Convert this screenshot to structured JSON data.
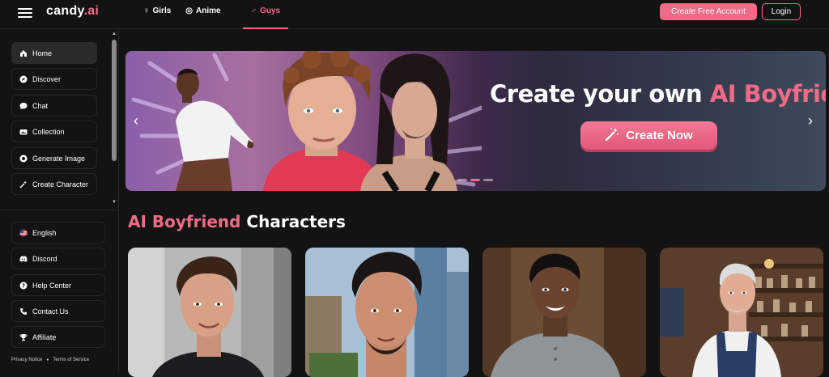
{
  "header": {
    "logo_text": "candy",
    "logo_suffix": ".ai",
    "nav": [
      {
        "label": "Girls",
        "icon": "female-icon"
      },
      {
        "label": "Anime",
        "icon": "anime-icon"
      },
      {
        "label": "Guys",
        "icon": "male-icon"
      }
    ],
    "active_nav": "Guys",
    "create_account_label": "Create Free Account",
    "login_label": "Login",
    "accent_color": "#ef6b86"
  },
  "sidebar": {
    "items": [
      {
        "label": "Home",
        "icon": "home-icon"
      },
      {
        "label": "Discover",
        "icon": "compass-icon"
      },
      {
        "label": "Chat",
        "icon": "chat-bubble-icon"
      },
      {
        "label": "Collection",
        "icon": "collection-icon"
      },
      {
        "label": "Generate Image",
        "icon": "image-icon"
      },
      {
        "label": "Create Character",
        "icon": "magic-wand-icon"
      }
    ],
    "bottom_items": [
      {
        "label": "English",
        "icon": "us-flag-icon"
      },
      {
        "label": "Discord",
        "icon": "discord-icon"
      },
      {
        "label": "Help Center",
        "icon": "help-icon"
      },
      {
        "label": "Contact Us",
        "icon": "mail-icon"
      },
      {
        "label": "Affiliate",
        "icon": "trophy-icon"
      }
    ],
    "privacy_label": "Privacy Notice",
    "terms_label": "Terms of Service"
  },
  "banner": {
    "title_white": "Create your own",
    "title_pink": "AI Boyfriend",
    "cta_label": "Create Now"
  },
  "section": {
    "title_pink": "AI Boyfriend",
    "title_white": "Characters"
  }
}
